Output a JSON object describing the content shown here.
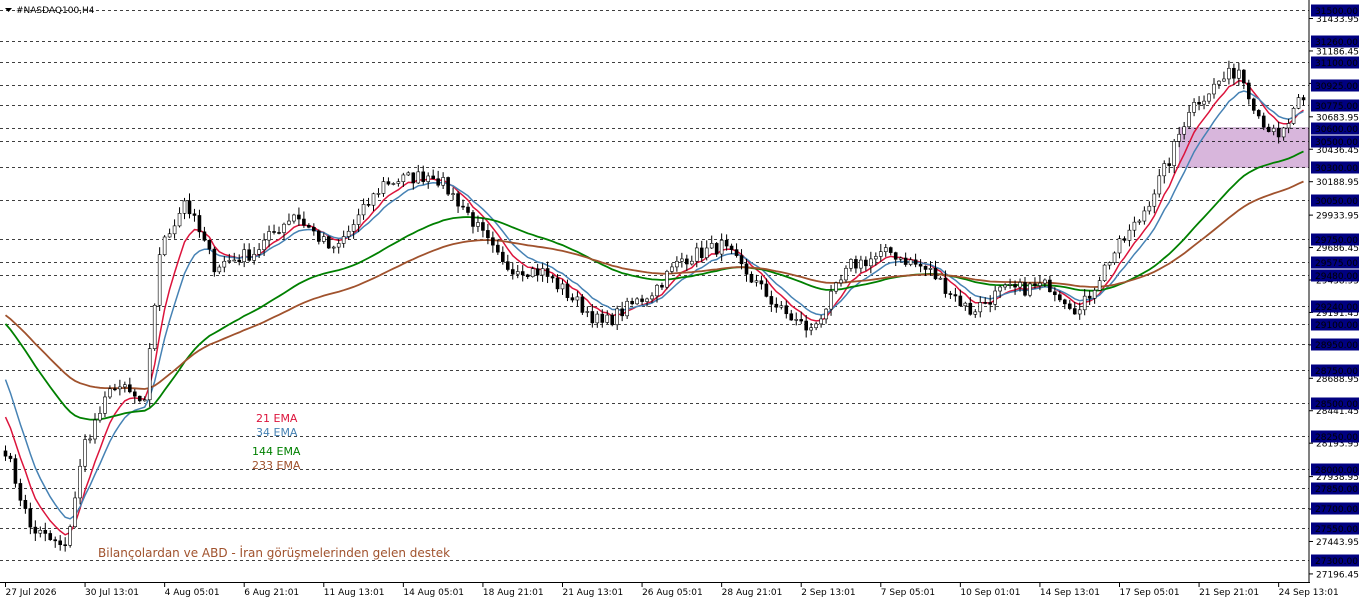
{
  "chart_data": {
    "type": "candlestick",
    "symbol_label": "#NASDAQ100,H4",
    "ylim": [
      27150,
      31560
    ],
    "price_ticks": [
      31433.95,
      31186.45,
      30938.95,
      30683.95,
      30436.45,
      30188.95,
      29933.95,
      29686.45,
      29438.95,
      29191.45,
      28943.95,
      28688.95,
      28441.45,
      28193.95,
      27938.95,
      27691.45,
      27443.95,
      27196.45
    ],
    "price_tick_labels": [
      "31433.95",
      "31186.45",
      "30938.95",
      "30683.95",
      "30436.45",
      "30188.95",
      "29933.95",
      "29686.45",
      "29438.95",
      "29191.45",
      "28943.95",
      "28688.95",
      "28441.45",
      "28193.95",
      "27938.95",
      "27691.45",
      "27443.95",
      "27196.45"
    ],
    "levels": [
      31500,
      31260,
      31100,
      30925,
      30775,
      30600,
      30500,
      30300,
      30050,
      29750,
      29575,
      29480,
      29240,
      29100,
      28950,
      28750,
      28500,
      28250,
      28000,
      27850,
      27700,
      27550,
      27300
    ],
    "level_labels": [
      "31500.00",
      "31260.00",
      "31100.00",
      "30925.00",
      "30775.00",
      "30600.00",
      "30500.00",
      "30300.00",
      "30050.00",
      "29750.00",
      "29575.00",
      "29480.00",
      "29240.00",
      "29100.00",
      "28950.00",
      "28750.00",
      "28500.00",
      "28250.00",
      "28000.00",
      "27850.00",
      "27700.00",
      "27550.00",
      "27300.00"
    ],
    "time_labels": [
      "27 Jul 2026",
      "30 Jul 13:01",
      "4 Aug 05:01",
      "6 Aug 21:01",
      "11 Aug 13:01",
      "14 Aug 05:01",
      "18 Aug 21:01",
      "21 Aug 13:01",
      "26 Aug 05:01",
      "28 Aug 21:01",
      "2 Sep 13:01",
      "7 Sep 05:01",
      "10 Sep 01:01",
      "14 Sep 13:01",
      "17 Sep 05:01",
      "21 Sep 21:01",
      "24 Sep 13:01"
    ],
    "time_label_index": [
      0,
      16,
      32,
      48,
      64,
      80,
      96,
      112,
      128,
      144,
      160,
      176,
      192,
      208,
      224,
      240,
      256
    ],
    "price_path": [
      [
        0,
        28150
      ],
      [
        5,
        27550
      ],
      [
        12,
        27380
      ],
      [
        16,
        28200
      ],
      [
        22,
        28650
      ],
      [
        28,
        28480
      ],
      [
        31,
        29650
      ],
      [
        36,
        30050
      ],
      [
        42,
        29550
      ],
      [
        50,
        29650
      ],
      [
        58,
        29950
      ],
      [
        66,
        29650
      ],
      [
        76,
        30180
      ],
      [
        86,
        30250
      ],
      [
        92,
        30000
      ],
      [
        100,
        29550
      ],
      [
        108,
        29500
      ],
      [
        114,
        29300
      ],
      [
        120,
        29100
      ],
      [
        130,
        29350
      ],
      [
        136,
        29600
      ],
      [
        144,
        29700
      ],
      [
        150,
        29450
      ],
      [
        156,
        29200
      ],
      [
        162,
        29050
      ],
      [
        170,
        29550
      ],
      [
        178,
        29650
      ],
      [
        186,
        29500
      ],
      [
        194,
        29200
      ],
      [
        200,
        29350
      ],
      [
        210,
        29400
      ],
      [
        216,
        29200
      ],
      [
        222,
        29600
      ],
      [
        228,
        29900
      ],
      [
        234,
        30350
      ],
      [
        238,
        30750
      ],
      [
        244,
        30950
      ],
      [
        248,
        31050
      ],
      [
        252,
        30700
      ],
      [
        256,
        30500
      ],
      [
        260,
        30780
      ]
    ],
    "series": [
      {
        "name": "21 EMA",
        "color": "#dc143c"
      },
      {
        "name": "34 EMA",
        "color": "#4682b4"
      },
      {
        "name": "144 EMA",
        "color": "#008000"
      },
      {
        "name": "233 EMA",
        "color": "#a0522d"
      }
    ],
    "zone": {
      "top": 30600,
      "bottom": 30300,
      "x_start": 236,
      "x_end": 262,
      "color": "#d8b6dc"
    },
    "annotation": {
      "text": "Bilançolardan ve ABD - İran görüşmelerinden gelen destek",
      "color": "#a0522d"
    },
    "candle_colors": {
      "body": "#000000",
      "wick": "#000000",
      "bull_fill": "#ffffff"
    },
    "level_label_bg": "#000080",
    "grid": false
  }
}
